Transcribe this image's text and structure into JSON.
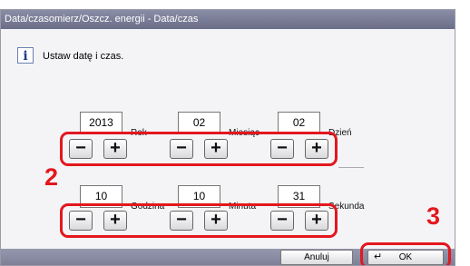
{
  "window": {
    "title": "Data/czasomierz/Oszcz. energii - Data/czas"
  },
  "message": "Ustaw datę i czas.",
  "info_icon_glyph": "i",
  "date": {
    "year": {
      "value": "2013",
      "label": "Rok"
    },
    "month": {
      "value": "02",
      "label": "Miesiąc"
    },
    "day": {
      "value": "02",
      "label": "Dzień"
    }
  },
  "time": {
    "hour": {
      "value": "10",
      "label": "Godzina"
    },
    "minute": {
      "value": "10",
      "label": "Minuta"
    },
    "second": {
      "value": "31",
      "label": "Sekunda"
    }
  },
  "buttons": {
    "minus": "−",
    "plus": "+",
    "cancel": "Anuluj",
    "ok": "OK",
    "enter_glyph": "↵"
  },
  "callouts": {
    "c2": "2",
    "c3": "3"
  },
  "colors": {
    "highlight": "#e3171e",
    "titlebar": "#7a7d96"
  }
}
